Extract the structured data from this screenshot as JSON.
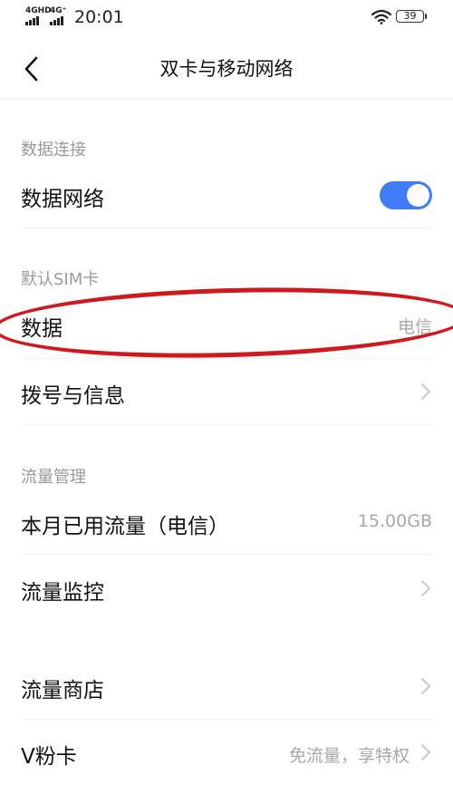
{
  "status_bar": {
    "network_1": "4GHD",
    "network_2": "4G⁺",
    "time": "20:01",
    "battery": "39"
  },
  "header": {
    "back_icon": "chevron-left-icon",
    "title": "双卡与移动网络"
  },
  "sections": {
    "data_connection": {
      "heading": "数据连接",
      "data_network_label": "数据网络",
      "data_network_on": true
    },
    "default_sim": {
      "heading": "默认SIM卡",
      "data_label": "数据",
      "data_value": "电信",
      "dial_label": "拨号与信息"
    },
    "traffic": {
      "heading": "流量管理",
      "used_label": "本月已用流量（电信）",
      "used_value": "15.00GB",
      "monitor_label": "流量监控"
    },
    "more": {
      "store_label": "流量商店",
      "vcard_label": "V粉卡",
      "vcard_value": "免流量，享特权"
    }
  },
  "colors": {
    "accent": "#3f7cf6",
    "annotation": "#d0181f"
  }
}
